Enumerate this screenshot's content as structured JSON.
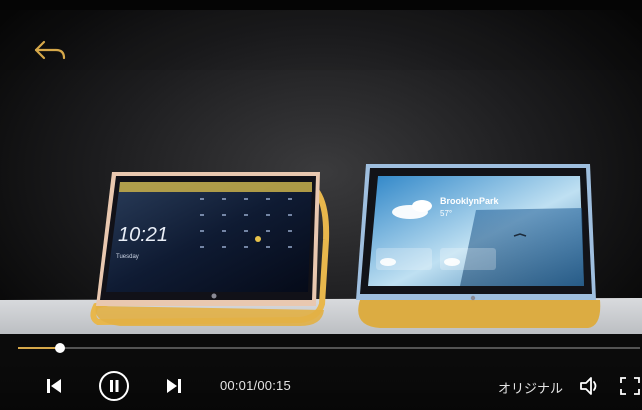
{
  "player": {
    "current_time": "00:01",
    "duration": "00:15",
    "time_separator": "/",
    "progress_fraction": 0.067,
    "quality_label": "オリジナル",
    "accent_color": "#d6a84a"
  },
  "icons": {
    "back": "back-arrow-icon",
    "previous": "skip-previous-icon",
    "pause": "pause-icon",
    "next": "skip-next-icon",
    "volume": "volume-icon",
    "fullscreen": "fullscreen-icon"
  },
  "video_scene": {
    "left_tablet": {
      "clock": "10:21",
      "day": "Tuesday"
    },
    "right_tablet": {
      "location": "BrooklynPark",
      "temperature": "57°"
    }
  }
}
